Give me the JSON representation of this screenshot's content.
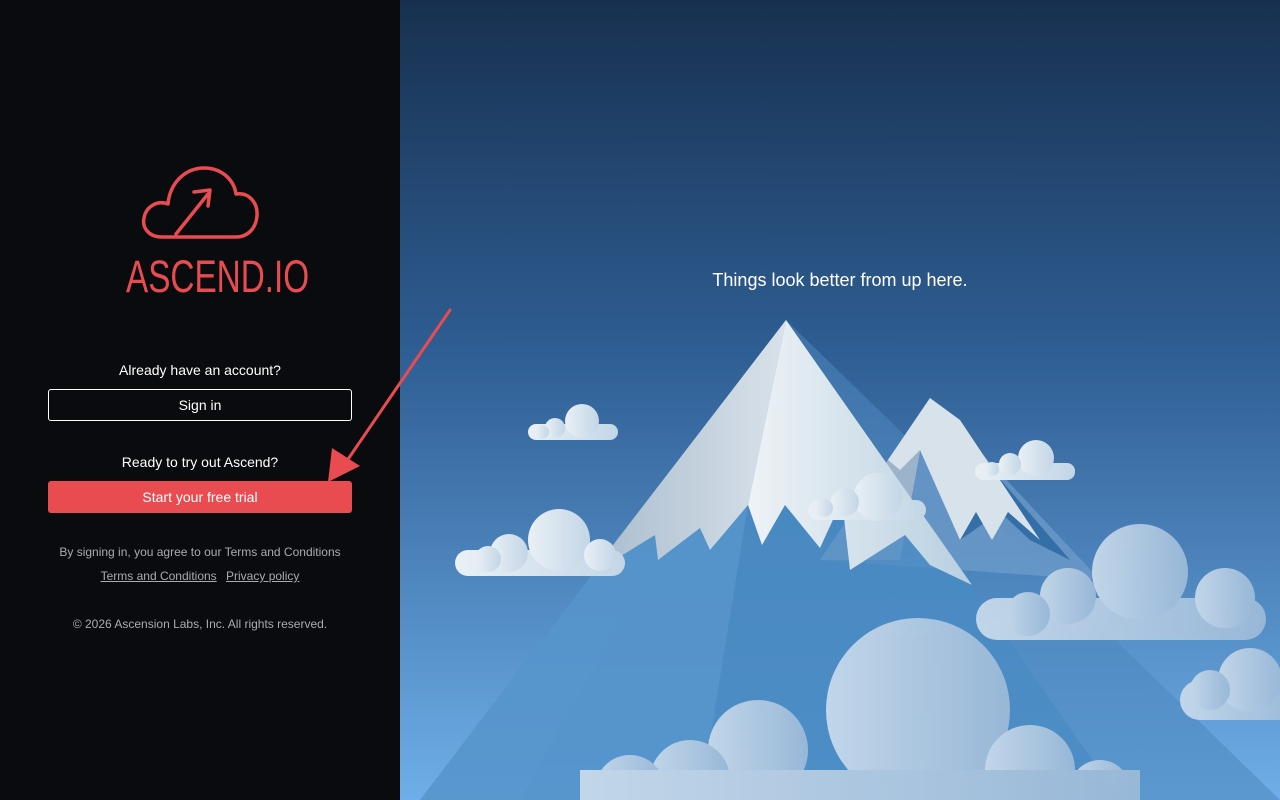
{
  "brand": {
    "name": "ASCEND.IO",
    "accent_color": "#e84c51",
    "logo_icon": "cloud-arrow-icon"
  },
  "auth": {
    "signin_prompt": "Already have an account?",
    "signin_label": "Sign in",
    "trial_prompt": "Ready to try out Ascend?",
    "trial_label": "Start your free trial"
  },
  "legal": {
    "agreement": "By signing in, you agree to our Terms and Conditions",
    "terms_link": "Terms and Conditions",
    "privacy_link": "Privacy policy",
    "copyright": "© 2026 Ascension Labs, Inc. All rights reserved."
  },
  "hero": {
    "tagline": "Things look better from up here.",
    "illustration": "mountain-clouds-illustration"
  },
  "annotation": {
    "icon": "red-arrow-pointer",
    "color": "#e84c51"
  }
}
